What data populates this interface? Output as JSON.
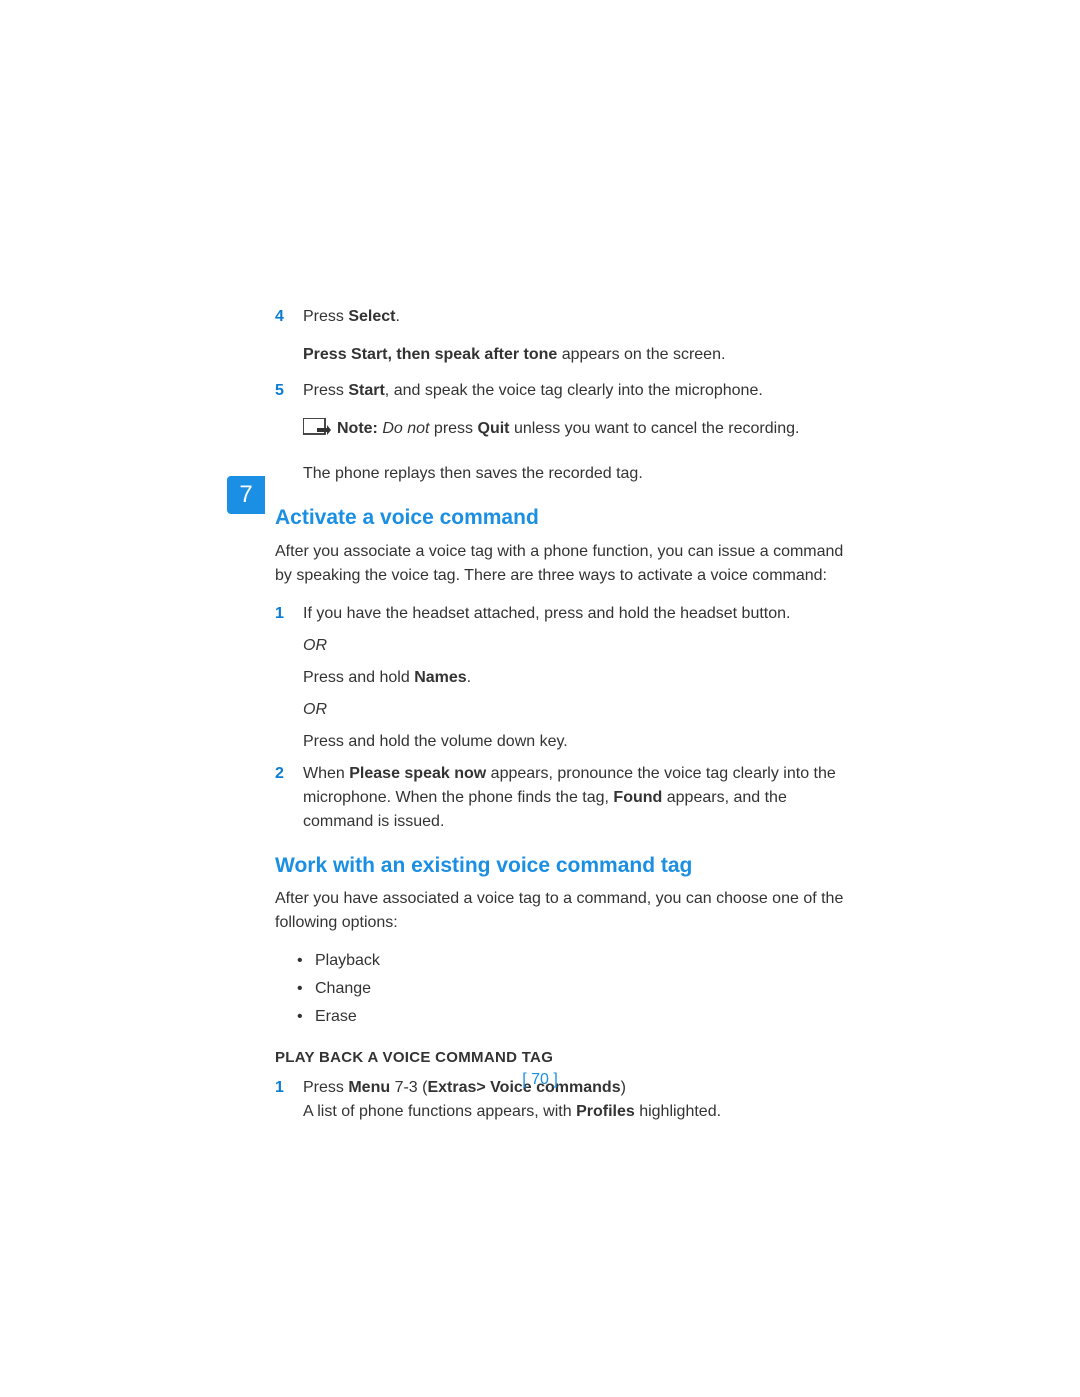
{
  "tab": {
    "chapter_number": "7"
  },
  "steps_top": [
    {
      "n": "4",
      "pre": "Press ",
      "bold": "Select",
      "post": "."
    },
    {
      "n": "5",
      "pre": "Press ",
      "bold": "Start",
      "post": ", and speak the voice tag clearly into the microphone."
    }
  ],
  "screen_msg": {
    "bold": "Press Start, then speak after tone",
    "rest": " appears on the screen."
  },
  "note": {
    "label": "Note:",
    "ital": " Do not ",
    "mid": "press ",
    "bold": "Quit",
    "rest": " unless you want to cancel the recording."
  },
  "after_note": "The phone replays then saves the recorded tag.",
  "h_activate": "Activate a voice command",
  "p_activate": "After you associate a voice tag with a phone function, you can issue a command by speaking the voice tag. There are three ways to activate a voice command:",
  "act_steps": {
    "s1_n": "1",
    "s1_text": "If you have the headset attached, press and hold the headset button.",
    "or": "OR",
    "s1_alt_pre": "Press and hold ",
    "s1_alt_bold": "Names",
    "s1_alt_post": ".",
    "s1_alt2": "Press and hold the volume down key.",
    "s2_n": "2",
    "s2_p1a": "When ",
    "s2_p1b": "Please speak now",
    "s2_p1c": " appears, pronounce the voice tag clearly into the microphone. When the phone finds the tag, ",
    "s2_p1d": "Found",
    "s2_p1e": " appears, and the command is issued."
  },
  "h_work": "Work with an existing voice command tag",
  "p_work": "After you have associated a voice tag to a command, you can choose one of the following options:",
  "bullets": [
    "Playback",
    "Change",
    "Erase"
  ],
  "h_playback": "PLAY BACK A VOICE COMMAND TAG",
  "pb": {
    "n": "1",
    "pre": "Press ",
    "bold1": "Menu",
    "mid": " 7-3 (",
    "bold2": "Extras> Voice commands",
    "post": ")",
    "line2a": "A list of phone functions appears, with ",
    "line2b": "Profiles",
    "line2c": " highlighted."
  },
  "footer": {
    "page": "[ 70 ]"
  }
}
